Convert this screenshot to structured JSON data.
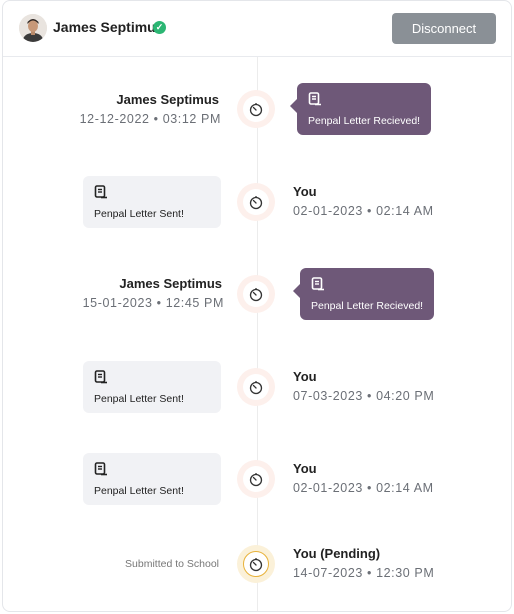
{
  "header": {
    "name": "James Septimus",
    "disconnect_label": "Disconnect"
  },
  "events": [
    {
      "sender": "James Septimus",
      "date": "12-12-2022",
      "time": "03:12 PM",
      "message": "Penpal Letter Recieved!"
    },
    {
      "sender": "You",
      "date": "02-01-2023",
      "time": "02:14 AM",
      "message": "Penpal Letter Sent!"
    },
    {
      "sender": "James Septimus",
      "date": "15-01-2023",
      "time": "12:45 PM",
      "message": "Penpal Letter Recieved!"
    },
    {
      "sender": "You",
      "date": "07-03-2023",
      "time": "04:20 PM",
      "message": "Penpal Letter Sent!"
    },
    {
      "sender": "You",
      "date": "02-01-2023",
      "time": "02:14 AM",
      "message": "Penpal Letter Sent!"
    },
    {
      "sender": "You (Pending)",
      "date": "14-07-2023",
      "time": "12:30 PM",
      "status": "Submitted to School"
    }
  ],
  "colors": {
    "received_bubble": "#6e5878",
    "sent_bubble": "#f1f2f5",
    "verified": "#2bb673",
    "disconnect_button": "#8a9096",
    "node_ring": "#fdf0ec",
    "pending_ring": "#fbf1d9"
  },
  "icons": {
    "verified": "check-badge-icon",
    "letter": "letter-icon",
    "node": "stopwatch-icon"
  }
}
